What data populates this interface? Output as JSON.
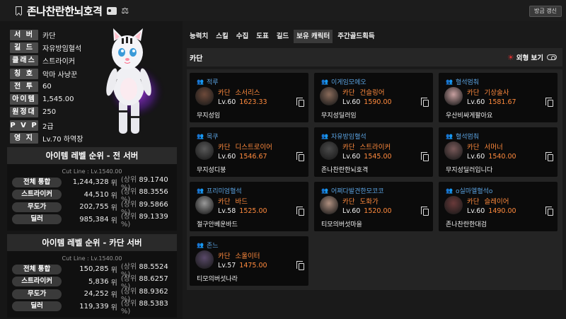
{
  "header": {
    "character_name": "존나찬란한뇌호격",
    "refresh_label": "갱신"
  },
  "profile": {
    "rows": [
      {
        "label": "서 버",
        "value": "카단"
      },
      {
        "label": "길 드",
        "value": "자유방임혈석"
      },
      {
        "label": "클래스",
        "value": "스트라이커"
      },
      {
        "label": "칭 호",
        "value": "악마 사냥꾼"
      },
      {
        "label": "전 투",
        "value": "60"
      },
      {
        "label": "아이템",
        "value": "1,545.00"
      },
      {
        "label": "원정대",
        "value": "250"
      },
      {
        "label": "P V P",
        "value": "2급"
      },
      {
        "label": "영 지",
        "value": "Lv.70 하역장"
      }
    ]
  },
  "rank_all": {
    "title": "아이템 레벨 순위 - 전 서버",
    "cutline": "Cut Line : Lv.1540.00",
    "rows": [
      {
        "label": "전체 통합",
        "rank": "1,244,328",
        "unit": "위",
        "pct": "89.1740"
      },
      {
        "label": "스트라이커",
        "rank": "44,510",
        "unit": "위",
        "pct": "88.3556"
      },
      {
        "label": "무도가",
        "rank": "202,755",
        "unit": "위",
        "pct": "89.5866"
      },
      {
        "label": "딜러",
        "rank": "985,384",
        "unit": "위",
        "pct": "89.1339"
      }
    ]
  },
  "rank_server": {
    "title": "아이템 레벨 순위 - 카단 서버",
    "cutline": "Cut Line : Lv.1540.00",
    "rows": [
      {
        "label": "전체 통합",
        "rank": "150,285",
        "unit": "위",
        "pct": "88.5524"
      },
      {
        "label": "스트라이커",
        "rank": "5,836",
        "unit": "위",
        "pct": "88.6257"
      },
      {
        "label": "무도가",
        "rank": "24,252",
        "unit": "위",
        "pct": "88.9362"
      },
      {
        "label": "딜러",
        "rank": "119,339",
        "unit": "위",
        "pct": "88.5383"
      }
    ]
  },
  "rank_pct_prefix": "(상위",
  "rank_pct_suffix": "%)",
  "tabs": [
    "능력치",
    "스킬",
    "수집",
    "도표",
    "길드",
    "보유 캐릭터",
    "주간골드획득"
  ],
  "active_tab": "보유 캐릭터",
  "server_bar": {
    "server": "카단",
    "appearance_label": "외형 보기"
  },
  "characters": [
    {
      "guild": "적루",
      "server": "카단",
      "class": "소서리스",
      "level": "Lv.60",
      "ilvl": "1623.33",
      "title": "무지성임",
      "portrait_color": "#6e4a3a"
    },
    {
      "guild": "이게임모에오",
      "server": "카단",
      "class": "건슬링어",
      "level": "Lv.60",
      "ilvl": "1590.00",
      "title": "무지성딜러임",
      "portrait_color": "#8a6b5a"
    },
    {
      "guild": "혈석멈춰",
      "server": "카단",
      "class": "기상술사",
      "level": "Lv.60",
      "ilvl": "1581.67",
      "title": "우산비싸게팔아요",
      "portrait_color": "#c8a0a0"
    },
    {
      "guild": "목쿠",
      "server": "카단",
      "class": "디스트로이어",
      "level": "Lv.60",
      "ilvl": "1546.67",
      "title": "무지성디붕",
      "portrait_color": "#5a5a5a"
    },
    {
      "guild": "자유방임혈석",
      "server": "카단",
      "class": "스트라이커",
      "level": "Lv.60",
      "ilvl": "1545.00",
      "title": "존나찬란한뇌호격",
      "portrait_color": "#4a4a4a"
    },
    {
      "guild": "혈석멈춰",
      "server": "카단",
      "class": "서머너",
      "level": "Lv.60",
      "ilvl": "1540.00",
      "title": "무지성딜러입니다",
      "portrait_color": "#7a5a5a"
    },
    {
      "guild": "프리미엄혈석",
      "server": "카단",
      "class": "바드",
      "level": "Lv.58",
      "ilvl": "1525.00",
      "title": "절구안베운바드",
      "portrait_color": "#9a9a9a"
    },
    {
      "guild": "어쩌다발견한모코코",
      "server": "카단",
      "class": "도화가",
      "level": "Lv.60",
      "ilvl": "1520.00",
      "title": "티모의버섯마을",
      "portrait_color": "#b09080"
    },
    {
      "guild": "o실마엘혈석o",
      "server": "카단",
      "class": "슬레이어",
      "level": "Lv.60",
      "ilvl": "1490.00",
      "title": "존나찬란한대검",
      "portrait_color": "#6a3a3a"
    },
    {
      "guild": "존느",
      "server": "카단",
      "class": "소울이터",
      "level": "Lv.57",
      "ilvl": "1475.00",
      "title": "티모의버섯나라",
      "portrait_color": "#5a4a6a"
    }
  ]
}
